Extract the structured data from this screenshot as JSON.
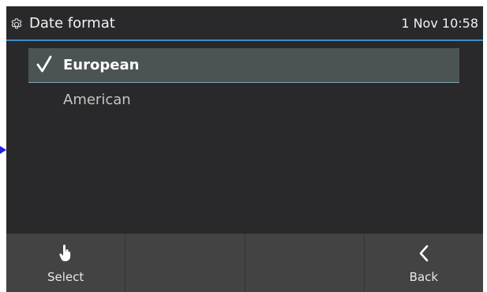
{
  "header": {
    "icon": "gear-icon",
    "title": "Date format",
    "clock": "1 Nov 10:58"
  },
  "list": {
    "items": [
      {
        "label": "European",
        "selected": true,
        "icon": "checkmark-icon"
      },
      {
        "label": "American",
        "selected": false
      }
    ]
  },
  "softkeys": [
    {
      "label": "Select",
      "icon": "hand-pointer-icon"
    },
    {
      "label": ""
    },
    {
      "label": ""
    },
    {
      "label": "Back",
      "icon": "chevron-left-icon"
    }
  ],
  "colors": {
    "background": "#29292b",
    "accent": "#3e8fc7",
    "selected_row": "#4c5453",
    "softkey_bar": "#434344"
  }
}
